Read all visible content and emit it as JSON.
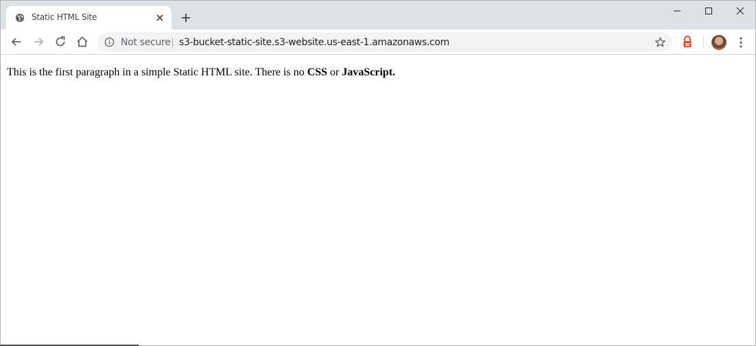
{
  "tab": {
    "title": "Static HTML Site"
  },
  "omnibox": {
    "security_label": "Not secure",
    "url": "s3-bucket-static-site.s3-website.us-east-1.amazonaws.com"
  },
  "page": {
    "text_before": "This is the first paragraph in a simple Static HTML site. There is no ",
    "bold_1": "CSS",
    "text_middle": " or ",
    "bold_2": "JavaScript."
  },
  "icons": [
    "globe-icon",
    "close-icon",
    "plus-icon",
    "minimize-icon",
    "maximize-icon",
    "window-close-icon",
    "back-icon",
    "forward-icon",
    "reload-icon",
    "home-icon",
    "info-icon",
    "star-icon",
    "extension-icon",
    "avatar",
    "more-menu-icon"
  ],
  "colors": {
    "tabstrip": "#dee1e6",
    "omnibox": "#f1f3f4",
    "extension": "#e8491d"
  }
}
